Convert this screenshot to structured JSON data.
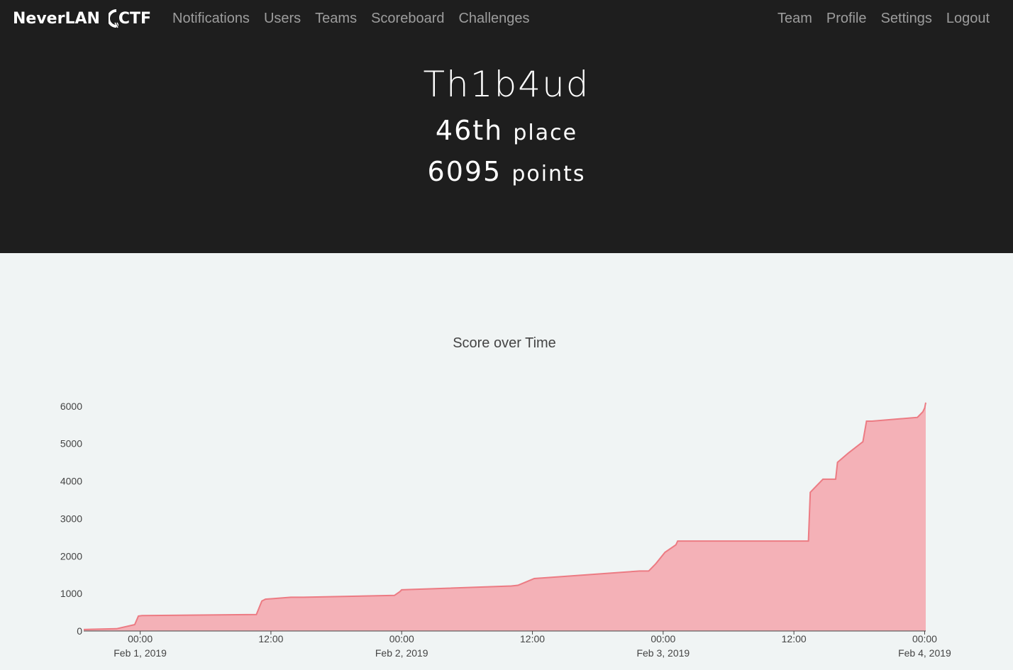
{
  "nav": {
    "brand": "NeverLAN",
    "brand_ctf": "CTF",
    "left": [
      "Notifications",
      "Users",
      "Teams",
      "Scoreboard",
      "Challenges"
    ],
    "right": [
      "Team",
      "Profile",
      "Settings",
      "Logout"
    ]
  },
  "profile": {
    "name": "Th1b4ud",
    "place_number": "46th",
    "place_label": "place",
    "points_number": "6095",
    "points_label": "points"
  },
  "colors": {
    "nav_bg": "#1e1e1e",
    "page_bg": "#f0f4f4",
    "area_fill": "#f4b1b7",
    "area_line": "#ec7b83"
  },
  "chart_data": {
    "type": "area",
    "title": "Score over Time",
    "xlabel": "",
    "ylabel": "",
    "ylim": [
      0,
      6300
    ],
    "xlim": [
      "2019-01-31T18:49",
      "2019-02-04T00:06"
    ],
    "y_ticks": [
      "0",
      "1000",
      "2000",
      "3000",
      "4000",
      "5000",
      "6000"
    ],
    "x_ticks": [
      {
        "time": "2019-02-01T00:00",
        "label": "00:00",
        "sublabel": "Feb 1, 2019"
      },
      {
        "time": "2019-02-01T12:00",
        "label": "12:00",
        "sublabel": ""
      },
      {
        "time": "2019-02-02T00:00",
        "label": "00:00",
        "sublabel": "Feb 2, 2019"
      },
      {
        "time": "2019-02-02T12:00",
        "label": "12:00",
        "sublabel": ""
      },
      {
        "time": "2019-02-03T00:00",
        "label": "00:00",
        "sublabel": "Feb 3, 2019"
      },
      {
        "time": "2019-02-03T12:00",
        "label": "12:00",
        "sublabel": ""
      },
      {
        "time": "2019-02-04T00:00",
        "label": "00:00",
        "sublabel": "Feb 4, 2019"
      }
    ],
    "grid": false,
    "series": [
      {
        "x": [
          "2019-01-31T18:49",
          "2019-01-31T21:50",
          "2019-01-31T23:30",
          "2019-01-31T23:50",
          "2019-02-01T00:10",
          "2019-02-01T10:40",
          "2019-02-01T11:10",
          "2019-02-01T11:30",
          "2019-02-01T13:50",
          "2019-02-01T15:00",
          "2019-02-01T23:20",
          "2019-02-01T23:50",
          "2019-02-02T00:00",
          "2019-02-02T09:50",
          "2019-02-02T10:00",
          "2019-02-02T10:40",
          "2019-02-02T11:20",
          "2019-02-02T12:10",
          "2019-02-02T21:50",
          "2019-02-02T22:40",
          "2019-02-02T23:20",
          "2019-02-03T00:10",
          "2019-02-03T01:10",
          "2019-02-03T01:20",
          "2019-02-03T13:20",
          "2019-02-03T13:30",
          "2019-02-03T14:40",
          "2019-02-03T15:50",
          "2019-02-03T16:00",
          "2019-02-03T17:00",
          "2019-02-03T18:20",
          "2019-02-03T18:40",
          "2019-02-03T19:10",
          "2019-02-03T23:20",
          "2019-02-03T23:50",
          "2019-02-04T00:00",
          "2019-02-04T00:06"
        ],
        "values": [
          40,
          60,
          170,
          400,
          410,
          440,
          800,
          850,
          900,
          900,
          950,
          1050,
          1100,
          1200,
          1200,
          1220,
          1300,
          1400,
          1600,
          1600,
          1800,
          2100,
          2300,
          2400,
          2400,
          3700,
          4050,
          4050,
          4500,
          4750,
          5050,
          5600,
          5600,
          5700,
          5850,
          5950,
          6095
        ]
      }
    ]
  }
}
